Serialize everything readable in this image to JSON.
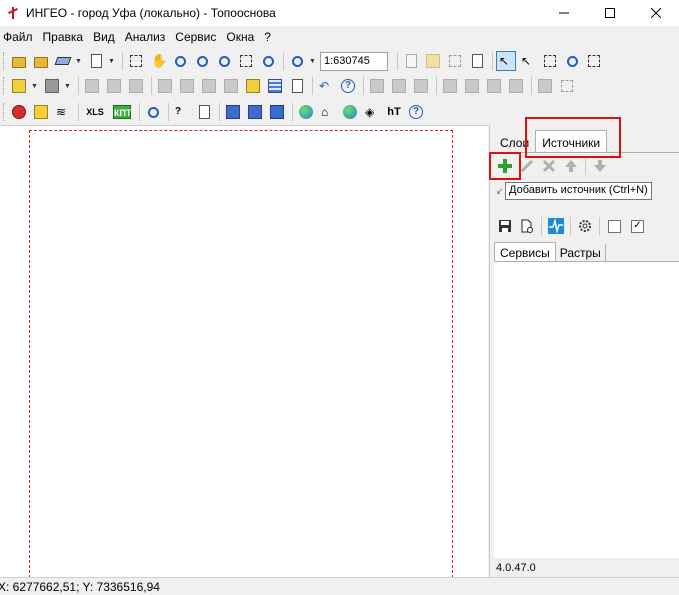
{
  "window": {
    "title": "ИНГЕО - город Уфа (локально) - Топооснова"
  },
  "menu": [
    "Файл",
    "Правка",
    "Вид",
    "Анализ",
    "Сервис",
    "Окна",
    "?"
  ],
  "toolbar": {
    "scale_value": "1:630745",
    "xls_label": "XLS",
    "kpt_label": "КПТ",
    "ht_label": "hT"
  },
  "panel": {
    "tabs": [
      "Слои",
      "Источники"
    ],
    "selected_tab": "Источники",
    "tooltip": "Добавить источник (Ctrl+N)",
    "subtabs": [
      "Сервисы",
      "Растры"
    ],
    "selected_subtab": "Сервисы",
    "version": "4.0.47.0"
  },
  "status": {
    "coordinates": "X: 6277662,51; Y: 7336516,94"
  },
  "colors": {
    "highlight": "#e01010",
    "add_green": "#2ea02e",
    "sheet_border": "#e02020"
  }
}
